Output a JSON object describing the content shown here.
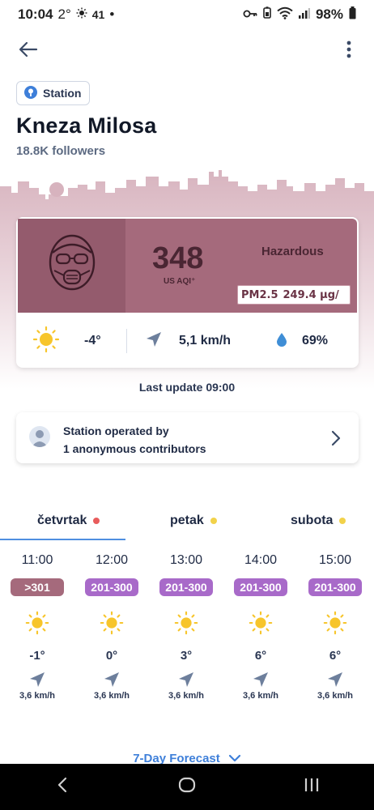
{
  "status_bar": {
    "time": "10:04",
    "temp": "2°",
    "notif_count": "41",
    "dot": "•",
    "battery": "98%"
  },
  "header": {
    "chip_label": "Station",
    "title": "Kneza Milosa",
    "followers": "18.8K followers"
  },
  "aqi": {
    "value": "348",
    "unit": "US AQI⁺",
    "level": "Hazardous",
    "pollutant": "PM2.5",
    "pollutant_value": "249.4 µg/",
    "top_color": "#a56a7c",
    "face_bg_color": "#945b6d"
  },
  "weather": {
    "temp": "-4°",
    "wind": "5,1 km/h",
    "humidity": "69%"
  },
  "last_update": "Last update 09:00",
  "contributors": {
    "line1": "Station operated by",
    "line2": "1 anonymous contributors"
  },
  "tabs": [
    {
      "label": "četvrtak",
      "dot_color": "#e85c5c"
    },
    {
      "label": "petak",
      "dot_color": "#f2d24a"
    },
    {
      "label": "subota",
      "dot_color": "#f2d24a"
    }
  ],
  "hourly": [
    {
      "time": "11:00",
      "aqi": ">301",
      "badge_color": "#a56a7c",
      "temp": "-1°",
      "wind": "3,6 km/h"
    },
    {
      "time": "12:00",
      "aqi": "201-300",
      "badge_color": "#a86ac9",
      "temp": "0°",
      "wind": "3,6 km/h"
    },
    {
      "time": "13:00",
      "aqi": "201-300",
      "badge_color": "#a86ac9",
      "temp": "3°",
      "wind": "3,6 km/h"
    },
    {
      "time": "14:00",
      "aqi": "201-300",
      "badge_color": "#a86ac9",
      "temp": "6°",
      "wind": "3,6 km/h"
    },
    {
      "time": "15:00",
      "aqi": "201-300",
      "badge_color": "#a86ac9",
      "temp": "6°",
      "wind": "3,6 km/h"
    }
  ],
  "forecast_link": "7-Day Forecast",
  "icons": [
    "back-arrow-icon",
    "more-vert-icon",
    "station-pin-icon",
    "gas-mask-icon",
    "sun-icon",
    "wind-direction-icon",
    "droplet-icon",
    "person-avatar-icon",
    "chevron-right-icon",
    "chevron-down-icon"
  ]
}
